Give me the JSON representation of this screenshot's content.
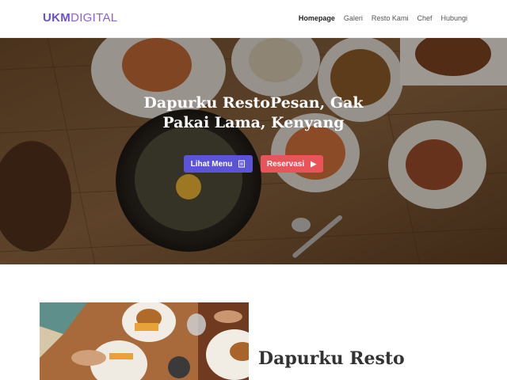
{
  "brand": {
    "logo_bold": "UKM",
    "logo_light": "DIGITAL"
  },
  "nav": {
    "items": [
      {
        "label": "Homepage",
        "active": true
      },
      {
        "label": "Galeri",
        "active": false
      },
      {
        "label": "Resto Kami",
        "active": false
      },
      {
        "label": "Chef",
        "active": false
      },
      {
        "label": "Hubungi",
        "active": false
      }
    ]
  },
  "hero": {
    "title_line1": "Dapurku RestoPesan, Gak",
    "title_line2": "Pakai Lama, Kenyang",
    "btn_menu_label": "Lihat Menu",
    "btn_menu_icon": "book-icon",
    "btn_reservasi_label": "Reservasi",
    "btn_reservasi_icon": "play-icon"
  },
  "about": {
    "title": "Dapurku Resto"
  },
  "colors": {
    "brand": "#6a4fd6",
    "menu_button": "#5b54d9",
    "reservasi_button": "#e8545a"
  }
}
